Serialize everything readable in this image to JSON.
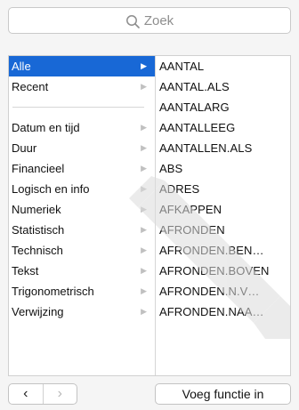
{
  "search": {
    "placeholder": "Zoek"
  },
  "categories": [
    {
      "label": "Alle",
      "selected": true
    },
    {
      "label": "Recent",
      "selected": false
    },
    {
      "separator": true
    },
    {
      "label": "Datum en tijd",
      "selected": false
    },
    {
      "label": "Duur",
      "selected": false
    },
    {
      "label": "Financieel",
      "selected": false
    },
    {
      "label": "Logisch en info",
      "selected": false
    },
    {
      "label": "Numeriek",
      "selected": false
    },
    {
      "label": "Statistisch",
      "selected": false
    },
    {
      "label": "Technisch",
      "selected": false
    },
    {
      "label": "Tekst",
      "selected": false
    },
    {
      "label": "Trigonometrisch",
      "selected": false
    },
    {
      "label": "Verwijzing",
      "selected": false
    }
  ],
  "functions": [
    "AANTAL",
    "AANTAL.ALS",
    "AANTALARG",
    "AANTALLEEG",
    "AANTALLEN.ALS",
    "ABS",
    "ADRES",
    "AFKAPPEN",
    "AFRONDEN",
    "AFRONDEN.BEN…",
    "AFRONDEN.BOVEN",
    "AFRONDEN.N.V…",
    "AFRONDEN.NAA…"
  ],
  "footer": {
    "prev_icon": "‹",
    "next_icon": "›",
    "insert_label": "Voeg functie in"
  },
  "icons": {
    "search": "search-icon",
    "arrow": "disclosure-arrow-icon",
    "watermark": "pencil-watermark-icon"
  },
  "colors": {
    "selection": "#1868d6",
    "watermark": "#dcdcdc"
  }
}
